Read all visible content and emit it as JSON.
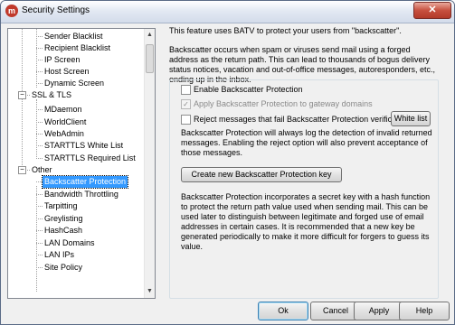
{
  "window": {
    "title": "Security Settings",
    "close_symbol": "✕",
    "app_icon_glyph": "m"
  },
  "tree": {
    "items": [
      {
        "label": "Sender Blacklist"
      },
      {
        "label": "Recipient Blacklist"
      },
      {
        "label": "IP Screen"
      },
      {
        "label": "Host Screen"
      },
      {
        "label": "Dynamic Screen"
      },
      {
        "label": "SSL & TLS",
        "group": true,
        "expanded": true
      },
      {
        "label": "MDaemon"
      },
      {
        "label": "WorldClient"
      },
      {
        "label": "WebAdmin"
      },
      {
        "label": "STARTTLS White List"
      },
      {
        "label": "STARTTLS Required List"
      },
      {
        "label": "Other",
        "group": true,
        "expanded": true
      },
      {
        "label": "Backscatter Protection",
        "selected": true
      },
      {
        "label": "Bandwidth Throttling"
      },
      {
        "label": "Tarpitting"
      },
      {
        "label": "Greylisting"
      },
      {
        "label": "HashCash"
      },
      {
        "label": "LAN Domains"
      },
      {
        "label": "LAN IPs"
      },
      {
        "label": "Site Policy"
      }
    ],
    "expander_symbol": "−"
  },
  "main": {
    "intro": "This feature uses BATV to protect your users from \"backscatter\".",
    "description": "Backscatter occurs when spam or viruses send mail using a forged address as the return path. This can lead to thousands of bogus delivery status notices, vacation and out-of-office messages, autoresponders, etc., ending up in the inbox.",
    "enable_label": "Enable Backscatter Protection",
    "enable_checked": false,
    "gateway_label": "Apply Backscatter Protection to gateway domains",
    "gateway_checked": true,
    "gateway_enabled": false,
    "reject_label": "Reject messages that fail Backscatter Protection verification",
    "reject_checked": false,
    "white_list_label": "White list",
    "logging_note": "Backscatter Protection will always log the detection of invalid returned messages. Enabling the reject option will also prevent acceptance of those messages.",
    "create_key_label": "Create new Backscatter Protection key",
    "key_note": "Backscatter Protection incorporates a secret key with a hash function to protect the return path value used when sending mail. This can be used later to distinguish between legitimate and forged use of email addresses in certain cases. It is recommended that a new key be generated periodically to make it more difficult for forgers to guess its value."
  },
  "footer": {
    "ok": "Ok",
    "cancel": "Cancel",
    "apply": "Apply",
    "help": "Help"
  },
  "colors": {
    "selection": "#3399ff",
    "window_bg": "#f0f0f0",
    "close_button": "#c7503f"
  }
}
